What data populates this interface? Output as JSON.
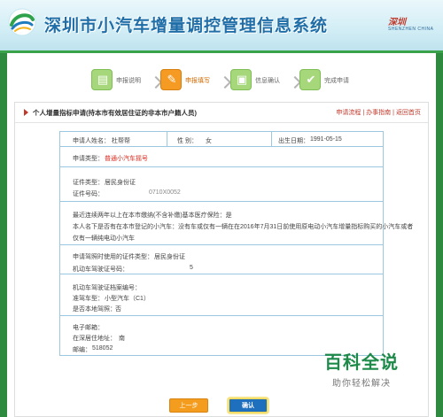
{
  "header": {
    "title": "深圳市小汽车增量调控管理信息系统",
    "logo_brand": "深圳",
    "logo_sub": "SHENZHEN CHINA",
    "swirl_icon": "swirl-logo-icon"
  },
  "steps": [
    {
      "label": "申报说明",
      "icon": "document-check-icon",
      "active": false
    },
    {
      "label": "申报填写",
      "icon": "pencil-edit-icon",
      "active": true
    },
    {
      "label": "信息确认",
      "icon": "form-confirm-icon",
      "active": false
    },
    {
      "label": "完成申请",
      "icon": "checkmark-icon",
      "active": false
    }
  ],
  "panel": {
    "title": "个人增量指标申请(持本市有效居住证的非本市户籍人员)",
    "links": [
      "申请流程",
      "办事指南",
      "返回首页"
    ]
  },
  "form": {
    "applicant_name_label": "申请人姓名：",
    "applicant_name": "杜帮帮",
    "gender_label": "性 别：",
    "gender": "女",
    "birthdate_label": "出生日期：",
    "birthdate": "1991-05-15",
    "apply_type_label": "申请类型：",
    "apply_type": "普通小汽车摇号",
    "id_type_label": "证件类型：",
    "id_type": "居民身份证",
    "id_no_label": "证件号码：",
    "id_no_fragment": "0710X0052",
    "q1": "最近连续两年以上在本市缴纳(不含补缴)基本医疗保险：是",
    "q2_line1": "本人名下是否有在本市登记的小汽车：没有车或仅有一辆在在2016年7月31日前使用原电动小汽车增量指标购买的小汽车或者",
    "q2_line2": "仅有一辆纯电动小汽车",
    "drive_id_type_label": "申请驾照时使用的证件类型：",
    "drive_id_type": "居民身份证",
    "license_no_label": "机动车驾驶证号码：",
    "license_no_fragment": "5",
    "file_no_label": "机动车驾驶证档案编号：",
    "class_label": "准驾车型：",
    "class_value": "小型汽车（C1）",
    "local_label": "是否本地驾照：",
    "local_value": "否",
    "email_label": "电子邮箱：",
    "address_label": "在深居住地址：",
    "address_fragment": "南",
    "postcode_label": "邮编：",
    "postcode": "518052"
  },
  "buttons": {
    "prev": "上一步",
    "confirm": "确认"
  },
  "watermark": {
    "line1": "百科全说",
    "line2": "助你轻松解决"
  },
  "colors": {
    "header_green": "#2e8a3f",
    "step_active": "#f59a23",
    "step_done": "#a6d77b",
    "link_red": "#c0392b",
    "confirm_blue": "#1f6fbf"
  }
}
